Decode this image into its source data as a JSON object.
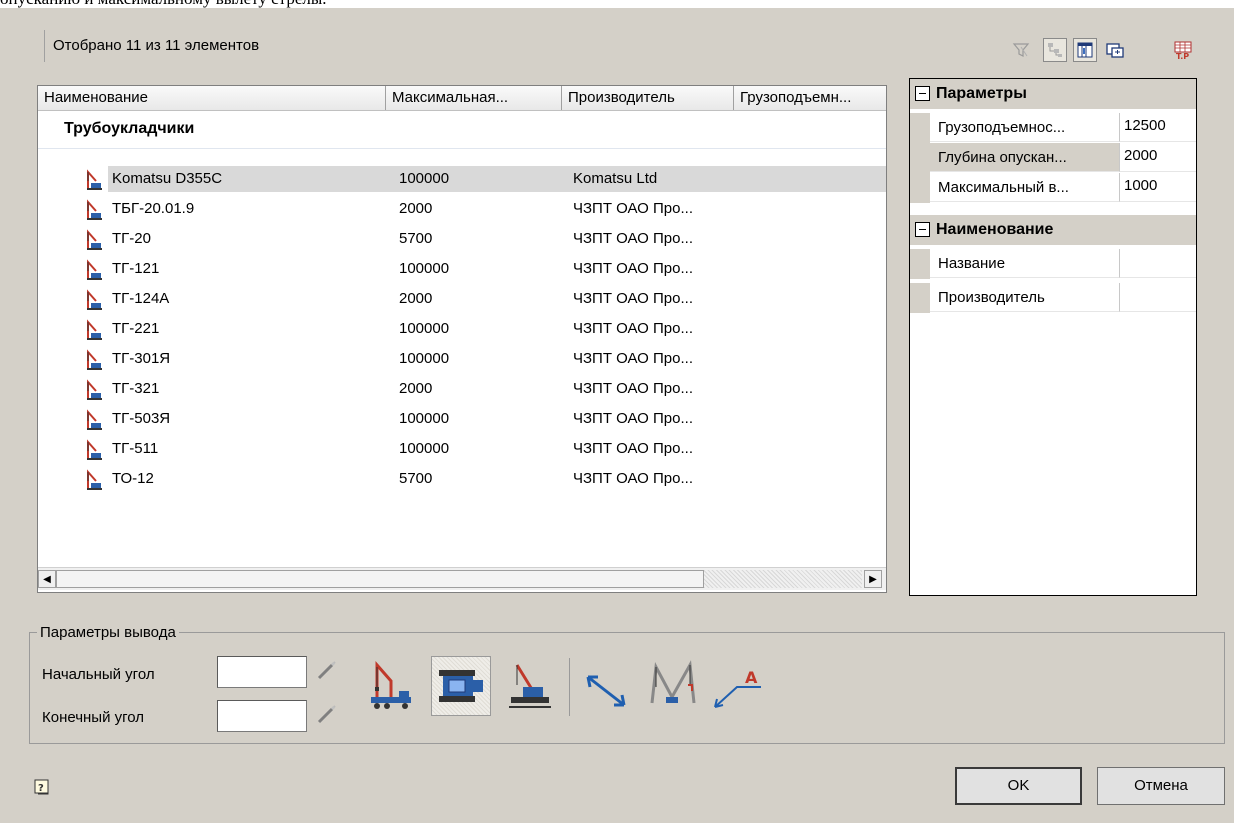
{
  "header_text": "опусканию и максимальному вылету стрелы.",
  "count_label": "Отобрано 11 из 11 элементов",
  "toolbar": {
    "icons": [
      "filter-icon",
      "hierarchy-icon",
      "columns-icon",
      "preview-icon",
      "table-settings-icon"
    ]
  },
  "grid": {
    "columns": [
      "Наименование",
      "Максимальная...",
      "Производитель",
      "Грузоподъемн..."
    ],
    "group": "Трубоукладчики",
    "rows": [
      {
        "name": "Komatsu D355C",
        "max": "100000",
        "maker": "Komatsu Ltd"
      },
      {
        "name": "ТБГ-20.01.9",
        "max": "2000",
        "maker": "ЧЗПТ ОАО Про..."
      },
      {
        "name": "ТГ-20",
        "max": "5700",
        "maker": "ЧЗПТ ОАО Про..."
      },
      {
        "name": "ТГ-121",
        "max": "100000",
        "maker": "ЧЗПТ ОАО Про..."
      },
      {
        "name": "ТГ-124А",
        "max": "2000",
        "maker": "ЧЗПТ ОАО Про..."
      },
      {
        "name": "ТГ-221",
        "max": "100000",
        "maker": "ЧЗПТ ОАО Про..."
      },
      {
        "name": "ТГ-301Я",
        "max": "100000",
        "maker": "ЧЗПТ ОАО Про..."
      },
      {
        "name": "ТГ-321",
        "max": "2000",
        "maker": "ЧЗПТ ОАО Про..."
      },
      {
        "name": "ТГ-503Я",
        "max": "100000",
        "maker": "ЧЗПТ ОАО Про..."
      },
      {
        "name": "ТГ-511",
        "max": "100000",
        "maker": "ЧЗПТ ОАО Про..."
      },
      {
        "name": "ТО-12",
        "max": "5700",
        "maker": "ЧЗПТ ОАО Про..."
      }
    ],
    "selected_row": 0
  },
  "props": {
    "cat1": "Параметры",
    "p1_name": "Грузоподъемнос...",
    "p1_val": "12500",
    "p2_name": "Глубина опускан...",
    "p2_val": "2000",
    "p3_name": "Максимальный в...",
    "p3_val": "1000",
    "cat2": "Наименование",
    "p4_name": "Название",
    "p4_val": "",
    "p5_name": "Производитель",
    "p5_val": ""
  },
  "output": {
    "legend": "Параметры вывода",
    "start_angle_label": "Начальный угол",
    "start_angle_value": "",
    "end_angle_label": "Конечный угол",
    "end_angle_value": "",
    "icons": [
      "crane-truck-icon",
      "crawler-top-view-icon",
      "pipelayer-icon",
      "dimension-icon",
      "boom-reach-icon",
      "leader-label-icon"
    ],
    "leader_letter": "A"
  },
  "buttons": {
    "ok": "OK",
    "cancel": "Отмена"
  },
  "colors": {
    "dialog_bg": "#d4d0c8",
    "selection": "#d9d9d9",
    "crane_red": "#c0392b",
    "crane_blue": "#2b5fa8"
  }
}
